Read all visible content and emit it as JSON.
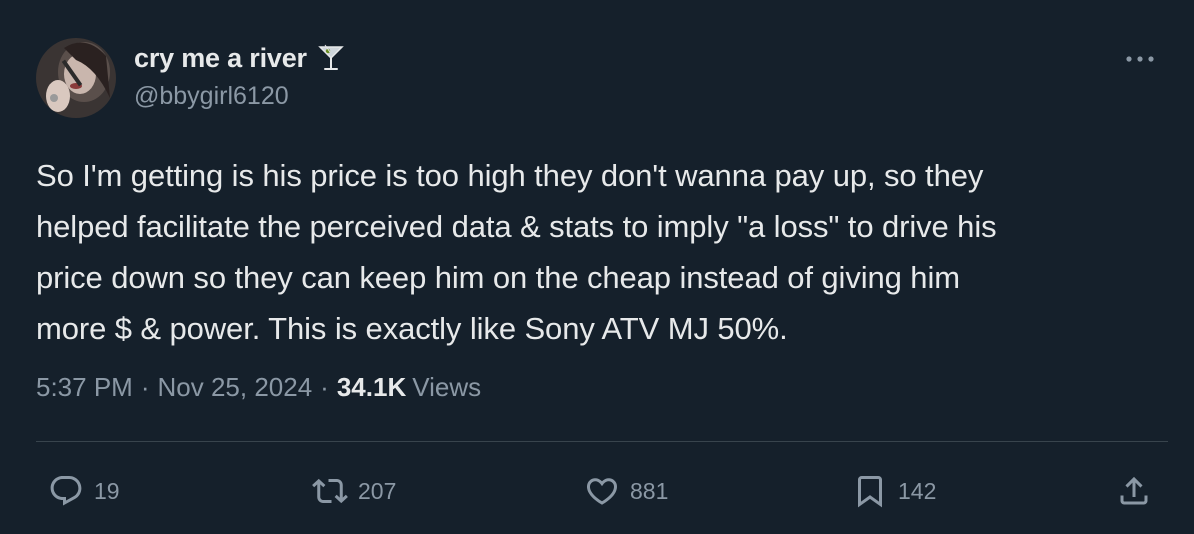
{
  "author": {
    "display_name": "cry me a river",
    "handle": "@bbygirl6120",
    "name_emoji": "cocktail-glass-icon"
  },
  "tweet": {
    "text": "So I'm getting is his price is too high they don't wanna pay up, so they\nhelped facilitate the perceived data & stats to imply \"a loss\" to drive his\nprice down so they can keep him on the cheap instead of giving him\nmore $ & power. This is exactly like Sony ATV MJ 50%.",
    "time": "5:37 PM",
    "date": "Nov 25, 2024",
    "separator": "·",
    "views_count": "34.1K",
    "views_label": "Views"
  },
  "actions": {
    "replies": "19",
    "reposts": "207",
    "likes": "881",
    "bookmarks": "142"
  },
  "colors": {
    "background": "#15202b",
    "text_primary": "#e7e9ea",
    "text_secondary": "#8b98a5",
    "divider": "#38444d"
  }
}
